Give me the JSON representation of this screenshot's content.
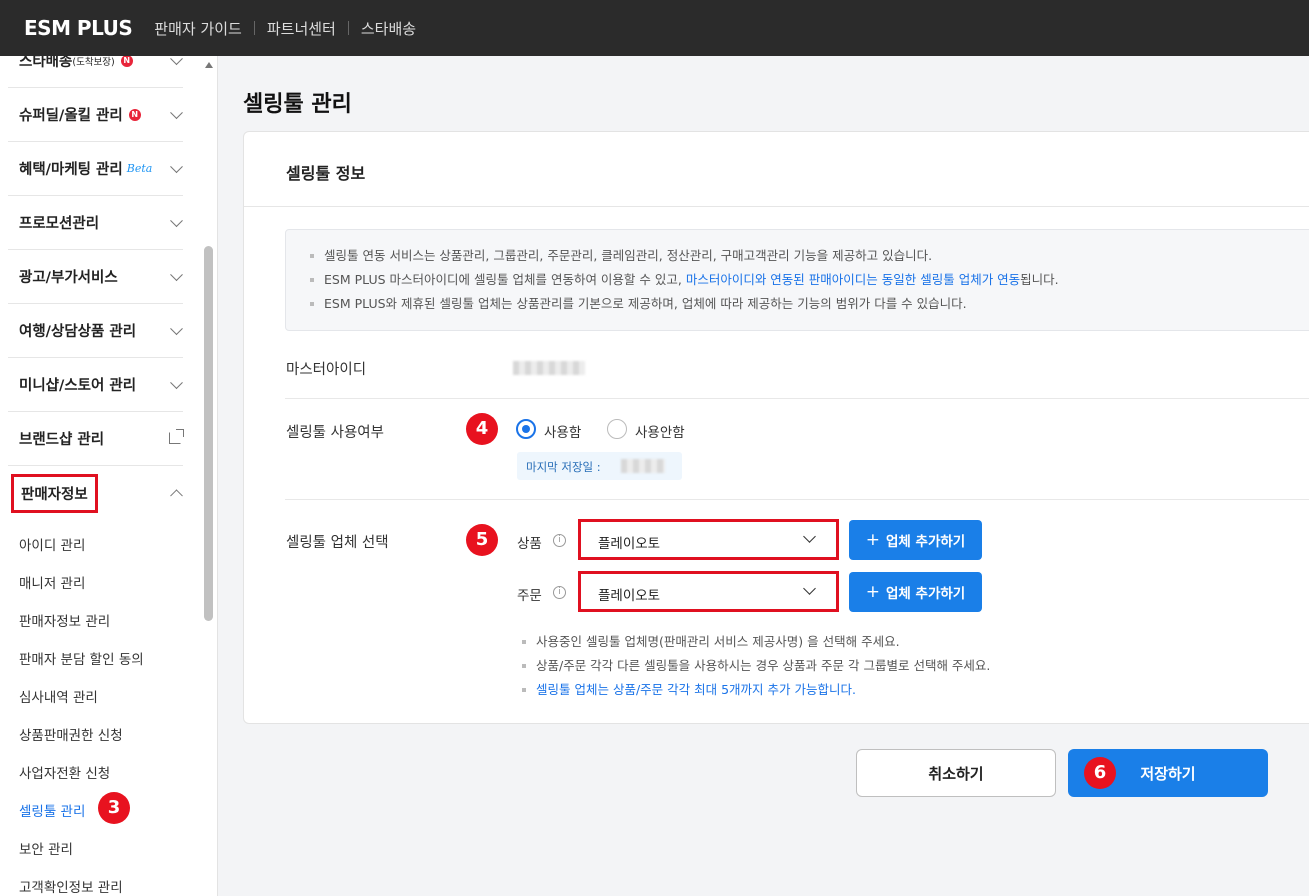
{
  "topbar": {
    "logo": "ESM PLUS",
    "nav": [
      "판매자 가이드",
      "파트너센터",
      "스타배송"
    ]
  },
  "sidebar": {
    "menu": [
      {
        "label": "스타배송",
        "sub": "(도착보장)",
        "badge": "N"
      },
      {
        "label": "슈퍼딜/올킬 관리",
        "badge": "N"
      },
      {
        "label": "혜택/마케팅 관리",
        "tag": "Beta"
      },
      {
        "label": "프로모션관리"
      },
      {
        "label": "광고/부가서비스"
      },
      {
        "label": "여행/상담상품 관리"
      },
      {
        "label": "미니샵/스토어 관리"
      },
      {
        "label": "브랜드샵 관리"
      },
      {
        "label": "판매자정보"
      }
    ],
    "sub_items": [
      "아이디 관리",
      "매니저 관리",
      "판매자정보 관리",
      "판매자 분담 할인 동의",
      "심사내역 관리",
      "상품판매권한 신청",
      "사업자전환 신청",
      "셀링툴 관리",
      "보안 관리",
      "고객확인정보 관리"
    ],
    "active_sub": "셀링툴 관리"
  },
  "steps": {
    "s3": "3",
    "s4": "4",
    "s5": "5",
    "s6": "6"
  },
  "main": {
    "page_title": "셀링툴 관리",
    "card_title": "셀링툴 정보",
    "notice": {
      "line1": "셀링툴 연동 서비스는 상품관리, 그룹관리, 주문관리, 클레임관리, 정산관리, 구매고객관리 기능을 제공하고 있습니다.",
      "line2_a": "ESM PLUS 마스터아이디에 셀링툴 업체를 연동하여 이용할 수 있고, ",
      "line2_b": "마스터아이디와 연동된 판매아이디는 동일한 셀링툴 업체가 연동",
      "line2_c": "됩니다.",
      "line3": "ESM PLUS와 제휴된 셀링툴 업체는 상품관리를 기본으로 제공하며, 업체에 따라 제공하는 기능의 범위가 다를 수 있습니다."
    },
    "master_id_label": "마스터아이디",
    "usage_label": "셀링툴 사용여부",
    "usage_on": "사용함",
    "usage_off": "사용안함",
    "last_saved": "마지막 저장일 :",
    "vendor_label": "셀링툴 업체 선택",
    "product_label": "상품",
    "order_label": "주문",
    "info_glyph": "i",
    "product_value": "플레이오토",
    "order_value": "플레이오토",
    "add_plus": "+",
    "add_vendor": "업체 추가하기",
    "hints": [
      "사용중인 셀링툴 업체명(판매관리 서비스 제공사명) 을 선택해 주세요.",
      "상품/주문 각각 다른 셀링툴을 사용하시는 경우 상품과 주문 각 그룹별로 선택해 주세요.",
      "셀링툴 업체는 상품/주문 각각 최대 5개까지 추가 가능합니다."
    ],
    "cancel": "취소하기",
    "save": "저장하기"
  }
}
